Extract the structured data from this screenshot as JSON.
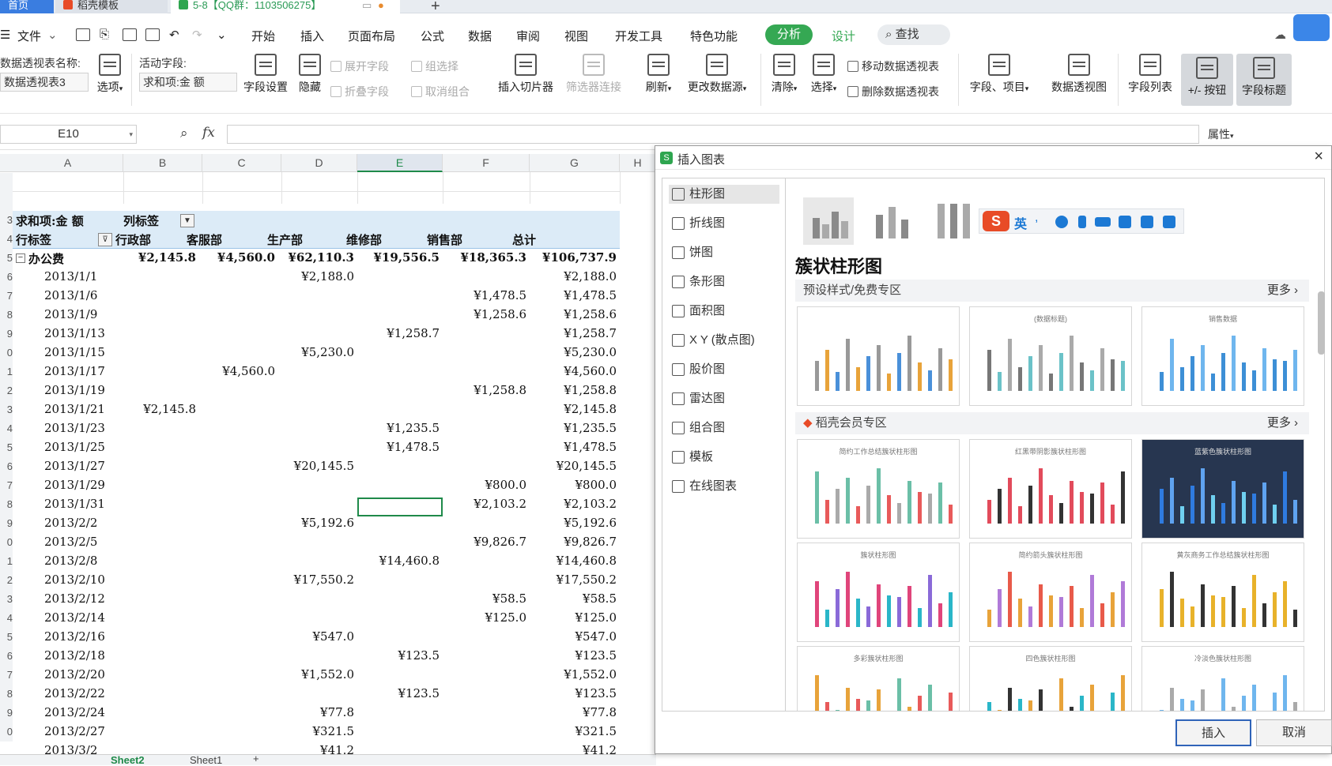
{
  "tabs": [
    {
      "label": "首页"
    },
    {
      "label": "稻壳模板"
    },
    {
      "label": "5-8【QQ群：1103506275】"
    }
  ],
  "menu": {
    "file": "文件",
    "items": [
      "开始",
      "插入",
      "页面布局",
      "公式",
      "数据",
      "审阅",
      "视图",
      "开发工具",
      "特色功能"
    ],
    "analyze": "分析",
    "design": "设计",
    "search": "查找"
  },
  "ribbon": {
    "pivot_name_label": "数据透视表名称:",
    "pivot_name_value": "数据透视表3",
    "options": "选项",
    "active_field_label": "活动字段:",
    "active_field_value": "求和项:金 额",
    "field_settings": "字段设置",
    "hide": "隐藏",
    "expand_field": "展开字段",
    "collapse_field": "折叠字段",
    "group_selection": "组选择",
    "ungroup": "取消组合",
    "insert_slicer": "插入切片器",
    "filter_connections": "筛选器连接",
    "refresh": "刷新",
    "change_source": "更改数据源",
    "clear": "清除",
    "select": "选择",
    "move_pivot": "移动数据透视表",
    "delete_pivot": "删除数据透视表",
    "fields_items": "字段、项目",
    "pivot_chart": "数据透视图",
    "field_list": "字段列表",
    "plus_minus": "+/- 按钮",
    "field_headers": "字段标题"
  },
  "formula_bar": {
    "name_box": "E10",
    "fx": "fx",
    "properties": "属性"
  },
  "sheet": {
    "columns": [
      "A",
      "B",
      "C",
      "D",
      "E",
      "F",
      "G",
      "H"
    ],
    "row_numbers": [
      "",
      "",
      "3",
      "4",
      "5",
      "6",
      "7",
      "8",
      "9",
      "0",
      "1",
      "2",
      "3",
      "4",
      "5",
      "6",
      "7",
      "8",
      "9",
      "0",
      "1",
      "2",
      "3",
      "4",
      "5",
      "6",
      "7",
      "8",
      "9",
      "0"
    ],
    "pivot_title": "求和项:金 额",
    "col_label_tag": "列标签",
    "row_label_tag": "行标签",
    "headers": [
      "行政部",
      "客服部",
      "生产部",
      "维修部",
      "销售部",
      "总计"
    ],
    "group": {
      "label": "办公费",
      "values": [
        "¥2,145.8",
        "¥4,560.0",
        "¥62,110.3",
        "¥19,556.5",
        "¥18,365.3",
        "¥106,737.9"
      ]
    },
    "rows": [
      {
        "date": "2013/1/1",
        "c": [
          "",
          "",
          "¥2,188.0",
          "",
          "",
          "¥2,188.0"
        ]
      },
      {
        "date": "2013/1/6",
        "c": [
          "",
          "",
          "",
          "",
          "¥1,478.5",
          "¥1,478.5"
        ]
      },
      {
        "date": "2013/1/9",
        "c": [
          "",
          "",
          "",
          "",
          "¥1,258.6",
          "¥1,258.6"
        ]
      },
      {
        "date": "2013/1/13",
        "c": [
          "",
          "",
          "",
          "¥1,258.7",
          "",
          "¥1,258.7"
        ]
      },
      {
        "date": "2013/1/15",
        "c": [
          "",
          "",
          "¥5,230.0",
          "",
          "",
          "¥5,230.0"
        ]
      },
      {
        "date": "2013/1/17",
        "c": [
          "",
          "¥4,560.0",
          "",
          "",
          "",
          "¥4,560.0"
        ]
      },
      {
        "date": "2013/1/19",
        "c": [
          "",
          "",
          "",
          "",
          "¥1,258.8",
          "¥1,258.8"
        ]
      },
      {
        "date": "2013/1/21",
        "c": [
          "¥2,145.8",
          "",
          "",
          "",
          "",
          "¥2,145.8"
        ]
      },
      {
        "date": "2013/1/23",
        "c": [
          "",
          "",
          "",
          "¥1,235.5",
          "",
          "¥1,235.5"
        ]
      },
      {
        "date": "2013/1/25",
        "c": [
          "",
          "",
          "",
          "¥1,478.5",
          "",
          "¥1,478.5"
        ]
      },
      {
        "date": "2013/1/27",
        "c": [
          "",
          "",
          "¥20,145.5",
          "",
          "",
          "¥20,145.5"
        ]
      },
      {
        "date": "2013/1/29",
        "c": [
          "",
          "",
          "",
          "",
          "¥800.0",
          "¥800.0"
        ]
      },
      {
        "date": "2013/1/31",
        "c": [
          "",
          "",
          "",
          "",
          "¥2,103.2",
          "¥2,103.2"
        ]
      },
      {
        "date": "2013/2/2",
        "c": [
          "",
          "",
          "¥5,192.6",
          "",
          "",
          "¥5,192.6"
        ]
      },
      {
        "date": "2013/2/5",
        "c": [
          "",
          "",
          "",
          "",
          "¥9,826.7",
          "¥9,826.7"
        ]
      },
      {
        "date": "2013/2/8",
        "c": [
          "",
          "",
          "",
          "¥14,460.8",
          "",
          "¥14,460.8"
        ]
      },
      {
        "date": "2013/2/10",
        "c": [
          "",
          "",
          "¥17,550.2",
          "",
          "",
          "¥17,550.2"
        ]
      },
      {
        "date": "2013/2/12",
        "c": [
          "",
          "",
          "",
          "",
          "¥58.5",
          "¥58.5"
        ]
      },
      {
        "date": "2013/2/14",
        "c": [
          "",
          "",
          "",
          "",
          "¥125.0",
          "¥125.0"
        ]
      },
      {
        "date": "2013/2/16",
        "c": [
          "",
          "",
          "¥547.0",
          "",
          "",
          "¥547.0"
        ]
      },
      {
        "date": "2013/2/18",
        "c": [
          "",
          "",
          "",
          "¥123.5",
          "",
          "¥123.5"
        ]
      },
      {
        "date": "2013/2/20",
        "c": [
          "",
          "",
          "¥1,552.0",
          "",
          "",
          "¥1,552.0"
        ]
      },
      {
        "date": "2013/2/22",
        "c": [
          "",
          "",
          "",
          "¥123.5",
          "",
          "¥123.5"
        ]
      },
      {
        "date": "2013/2/24",
        "c": [
          "",
          "",
          "¥77.8",
          "",
          "",
          "¥77.8"
        ]
      },
      {
        "date": "2013/2/27",
        "c": [
          "",
          "",
          "¥321.5",
          "",
          "",
          "¥321.5"
        ]
      },
      {
        "date": "2013/3/2",
        "c": [
          "",
          "",
          "¥41.2",
          "",
          "",
          "¥41.2"
        ]
      }
    ],
    "sheet_tabs": [
      "Sheet2",
      "Sheet1"
    ]
  },
  "dialog": {
    "title": "插入图表",
    "categories": [
      "柱形图",
      "折线图",
      "饼图",
      "条形图",
      "面积图",
      "X Y (散点图)",
      "股价图",
      "雷达图",
      "组合图",
      "模板",
      "在线图表"
    ],
    "subtype_title": "簇状柱形图",
    "section_preset": "预设样式/免费专区",
    "section_member": "稻壳会员专区",
    "more": "更多",
    "ime_label": "英",
    "thumbs_preset": [
      "",
      "(数据标题)",
      "销售数据"
    ],
    "thumbs_member": [
      "简约工作总结簇状柱形图",
      "红黑带阴影簇状柱形图",
      "蓝紫色簇状柱形图",
      "簇状柱形图",
      "简约箭头簇状柱形图",
      "黄灰商务工作总结簇状柱形图",
      "多彩簇状柱形图",
      "四色簇状柱形图",
      "冷淡色簇状柱形图"
    ],
    "insert": "插入",
    "cancel": "取消"
  },
  "colors": {
    "accent": "#35a853",
    "dialog_button_border": "#2f63b8",
    "pivot_header": "#dcebf7"
  }
}
